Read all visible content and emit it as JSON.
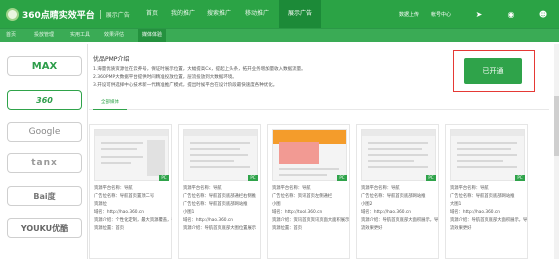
{
  "header": {
    "logo_text": "360点睛实效平台",
    "logo_sub": "展示广告",
    "nav": [
      "首页",
      "我的推广",
      "搜索推广",
      "移动推广",
      "展示广告"
    ],
    "active_nav": 4,
    "right_links": [
      "数据上传",
      "帐号中心"
    ],
    "right_icons": [
      "megaphone-icon",
      "lightbulb-icon",
      "user-icon"
    ]
  },
  "subnav": {
    "items": [
      "首页",
      "投放管理",
      "实用工具",
      "效果评估",
      "媒体体验"
    ],
    "active": 4
  },
  "sidebar": {
    "tiles": [
      "MAX",
      "360",
      "Google",
      "tanx",
      "Bai度",
      "YOUKU优酷"
    ]
  },
  "pmp": {
    "title": "优品PMP介绍",
    "lines": [
      "1.海量优质资源位在云养号，保证时展示位置，大幅提高Cx，提起上头条，拓开业务增加量收入数据流量。",
      "2.360PMP大数据平台提供时间精准投放位置，层流投放到大数据环境。",
      "3.开设可供选择中心技术新一代精准推广模式，提出时候平台在设计阶段最快速度各种优化。"
    ],
    "open_label": "已开通"
  },
  "tabs": {
    "all": "全部媒体"
  },
  "cards": [
    {
      "lines": [
        "资源平台名称：导航",
        "广告位名称：导航首页置顶二号",
        "资源位",
        "域名：http://hao.360.cn",
        "资源介绍：个性化定制，最大资源覆盖，引流新场景",
        "资源位置：首页"
      ],
      "badge": "PC"
    },
    {
      "lines": [
        "资源平台名称：导航",
        "广告位名称：导航首页底部通栏右侧推",
        "广告位名称：导航首页底部网站推",
        "小图1",
        "域名：http://hao.360.cn",
        "资源介绍：导航首页底部大图位置展示"
      ],
      "badge": "PC"
    },
    {
      "lines": [
        "资源平台名称：导航",
        "广告位名称：资讯首页左侧通栏",
        "小图",
        "域名：http://tool.360.cn",
        "资源介绍：资讯首页资讯页面大面积展示，可精准选择投放，锁定目标",
        "资源位置：首页"
      ],
      "badge": "PC"
    },
    {
      "lines": [
        "资源平台名称：导航",
        "广告位名称：导航首页底部网站推",
        "小图2",
        "域名：http://hao.360.cn",
        "资源介绍：导航首页底部大面积展示，导",
        "流效果更好"
      ],
      "badge": "PC"
    },
    {
      "lines": [
        "资源平台名称：导航",
        "广告位名称：导航首页底部网站推",
        "大图1",
        "域名：http://hao.360.cn",
        "资源介绍：导航首页底部大面积展示，导",
        "流效果更好"
      ],
      "badge": "PC"
    }
  ],
  "colors": {
    "brand_green": "#2ba345",
    "active_green": "#2fa34a",
    "highlight_red": "#e53935"
  }
}
